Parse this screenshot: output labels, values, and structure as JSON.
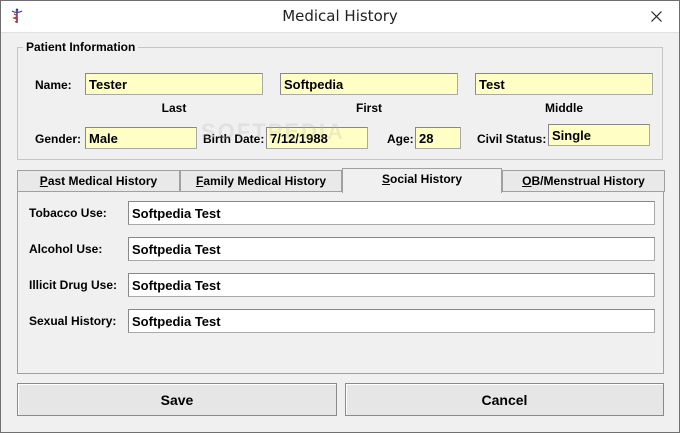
{
  "window": {
    "title": "Medical History"
  },
  "colors": {
    "field_yellow": "#ffffc5",
    "field_white": "#ffffff",
    "background": "#f0f0f0"
  },
  "patient": {
    "group_label": "Patient Information",
    "name_label": "Name:",
    "last": "Tester",
    "first": "Softpedia",
    "middle": "Test",
    "last_caption": "Last",
    "first_caption": "First",
    "middle_caption": "Middle",
    "gender_label": "Gender:",
    "gender": "Male",
    "birth_date_label": "Birth Date:",
    "birth_date": "7/12/1988",
    "age_label": "Age:",
    "age": "28",
    "civil_status_label": "Civil Status:",
    "civil_status": "Single"
  },
  "tabs": [
    {
      "first": "P",
      "rest": "ast Medical History",
      "active": false
    },
    {
      "first": "F",
      "rest": "amily Medical History",
      "active": false
    },
    {
      "first": "S",
      "rest": "ocial History",
      "active": true
    },
    {
      "first": "O",
      "rest": "B/Menstrual History",
      "active": false
    }
  ],
  "social": {
    "tobacco_label": "Tobacco Use:",
    "tobacco": "Softpedia Test",
    "alcohol_label": "Alcohol Use:",
    "alcohol": "Softpedia Test",
    "illicit_label": "Illicit Drug Use:",
    "illicit": "Softpedia Test",
    "sexual_label": "Sexual History:",
    "sexual": "Softpedia Test"
  },
  "buttons": {
    "save": "Save",
    "cancel": "Cancel"
  },
  "watermark": "SOFTPEDIA"
}
